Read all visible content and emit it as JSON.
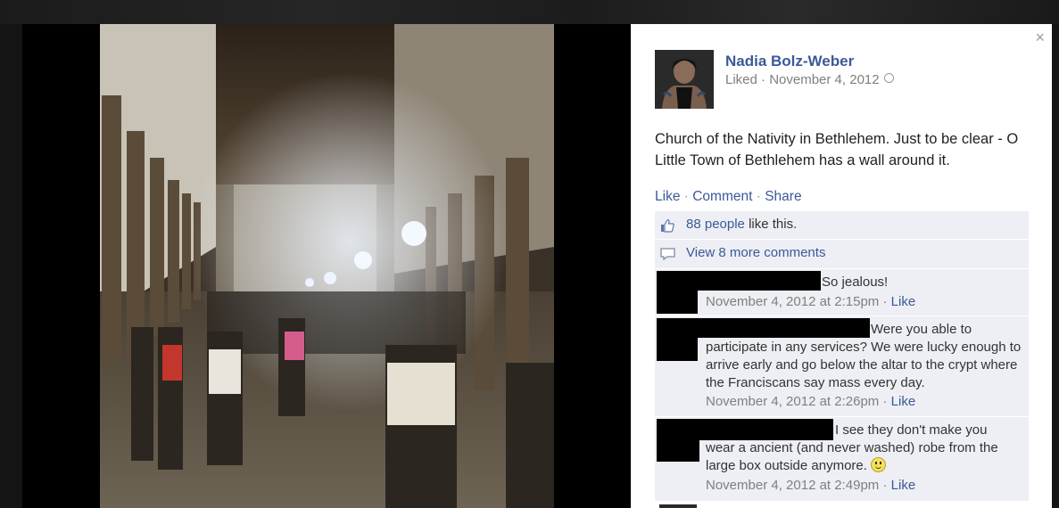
{
  "post": {
    "author": "Nadia Bolz-Weber",
    "meta": "Liked · November 4, 2012",
    "text": "Church of the Nativity in Bethlehem. Just to be clear - O Little Town of Bethlehem has a wall around it."
  },
  "actions": {
    "like": "Like",
    "comment": "Comment",
    "share": "Share",
    "separator": "·"
  },
  "likes": {
    "count_link": "88 people",
    "suffix": " like this."
  },
  "more_comments": "View 8 more comments",
  "comments": [
    {
      "text": "So jealous!",
      "time": "November 4, 2012 at 2:15pm",
      "like": "Like"
    },
    {
      "text_line1": "Were you able to",
      "text_rest": "participate in any services? We were lucky enough to arrive early and go below the altar to the crypt where the Franciscans say mass every day.",
      "time": "November 4, 2012 at 2:26pm",
      "like": "Like"
    },
    {
      "text_line1": "I see they don't make you",
      "text_rest": "wear a ancient (and never washed) robe from the large box outside anymore.",
      "time": "November 4, 2012 at 2:49pm",
      "like": "Like"
    }
  ],
  "close_symbol": "×",
  "icons": {
    "close": "close-icon",
    "globe": "globe-icon",
    "like": "thumbs-up-icon",
    "comment": "comment-bubble-icon",
    "emoticon": "smiley-icon"
  }
}
